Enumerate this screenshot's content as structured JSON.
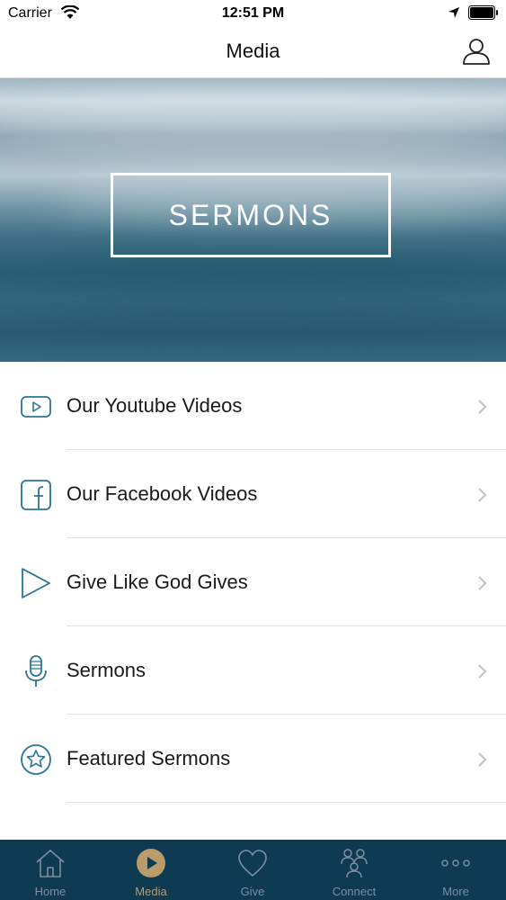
{
  "status_bar": {
    "carrier": "Carrier",
    "time": "12:51 PM"
  },
  "navbar": {
    "title": "Media",
    "profile_icon": "user-icon"
  },
  "hero": {
    "label": "SERMONS"
  },
  "menu": {
    "items": [
      {
        "label": "Our Youtube Videos",
        "icon": "youtube-icon"
      },
      {
        "label": "Our Facebook Videos",
        "icon": "facebook-icon"
      },
      {
        "label": "Give Like God Gives",
        "icon": "play-icon"
      },
      {
        "label": "Sermons",
        "icon": "microphone-icon"
      },
      {
        "label": "Featured Sermons",
        "icon": "star-icon"
      }
    ]
  },
  "tabbar": {
    "active": "Media",
    "tabs": [
      {
        "label": "Home",
        "icon": "home-icon"
      },
      {
        "label": "Media",
        "icon": "media-play-icon"
      },
      {
        "label": "Give",
        "icon": "heart-icon"
      },
      {
        "label": "Connect",
        "icon": "people-icon"
      },
      {
        "label": "More",
        "icon": "more-dots-icon"
      }
    ]
  },
  "colors": {
    "accent": "#2a7596",
    "tabbar_bg": "#0e3a52",
    "tab_active": "#b99c6a",
    "tab_inactive": "#7c8fa0"
  }
}
